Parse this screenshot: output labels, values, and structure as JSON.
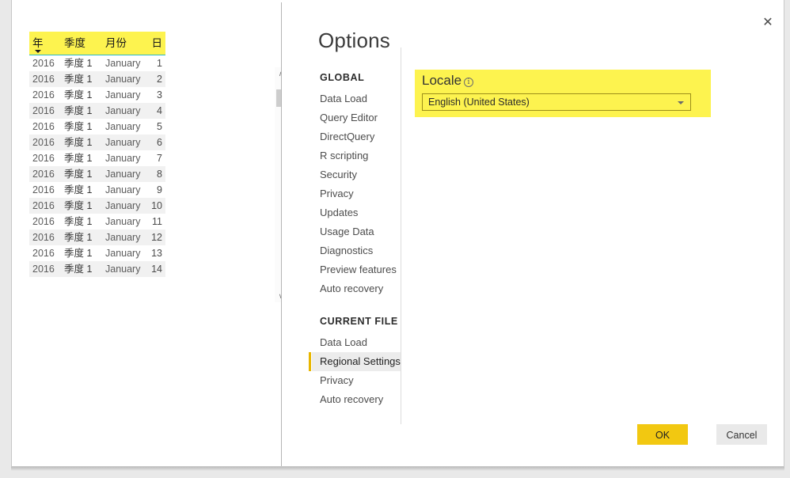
{
  "grid": {
    "columns": [
      {
        "label": "年",
        "align": "left",
        "sorted": true
      },
      {
        "label": "季度",
        "align": "left",
        "sorted": false
      },
      {
        "label": "月份",
        "align": "left",
        "sorted": false
      },
      {
        "label": "日",
        "align": "right",
        "sorted": false
      }
    ],
    "rows": [
      [
        "2016",
        "季度 1",
        "January",
        "1"
      ],
      [
        "2016",
        "季度 1",
        "January",
        "2"
      ],
      [
        "2016",
        "季度 1",
        "January",
        "3"
      ],
      [
        "2016",
        "季度 1",
        "January",
        "4"
      ],
      [
        "2016",
        "季度 1",
        "January",
        "5"
      ],
      [
        "2016",
        "季度 1",
        "January",
        "6"
      ],
      [
        "2016",
        "季度 1",
        "January",
        "7"
      ],
      [
        "2016",
        "季度 1",
        "January",
        "8"
      ],
      [
        "2016",
        "季度 1",
        "January",
        "9"
      ],
      [
        "2016",
        "季度 1",
        "January",
        "10"
      ],
      [
        "2016",
        "季度 1",
        "January",
        "11"
      ],
      [
        "2016",
        "季度 1",
        "January",
        "12"
      ],
      [
        "2016",
        "季度 1",
        "January",
        "13"
      ],
      [
        "2016",
        "季度 1",
        "January",
        "14"
      ]
    ],
    "scrollbar": {
      "up_glyph": "∧",
      "down_glyph": "∨"
    },
    "header_color": "#fdf34f",
    "header_underline_color": "#29b8c8"
  },
  "dialog": {
    "title": "Options",
    "close_glyph": "✕",
    "nav": {
      "groups": [
        {
          "title": "GLOBAL",
          "items": [
            {
              "label": "Data Load",
              "selected": false
            },
            {
              "label": "Query Editor",
              "selected": false
            },
            {
              "label": "DirectQuery",
              "selected": false
            },
            {
              "label": "R scripting",
              "selected": false
            },
            {
              "label": "Security",
              "selected": false
            },
            {
              "label": "Privacy",
              "selected": false
            },
            {
              "label": "Updates",
              "selected": false
            },
            {
              "label": "Usage Data",
              "selected": false
            },
            {
              "label": "Diagnostics",
              "selected": false
            },
            {
              "label": "Preview features",
              "selected": false
            },
            {
              "label": "Auto recovery",
              "selected": false
            }
          ]
        },
        {
          "title": "CURRENT FILE",
          "items": [
            {
              "label": "Data Load",
              "selected": false
            },
            {
              "label": "Regional Settings",
              "selected": true
            },
            {
              "label": "Privacy",
              "selected": false
            },
            {
              "label": "Auto recovery",
              "selected": false
            }
          ]
        }
      ]
    },
    "content": {
      "section_label": "Locale",
      "info_glyph": "i",
      "locale_value": "English (United States)",
      "highlight_color": "#fdf34f"
    },
    "footer": {
      "ok_label": "OK",
      "cancel_label": "Cancel",
      "ok_color": "#f2c811"
    }
  }
}
